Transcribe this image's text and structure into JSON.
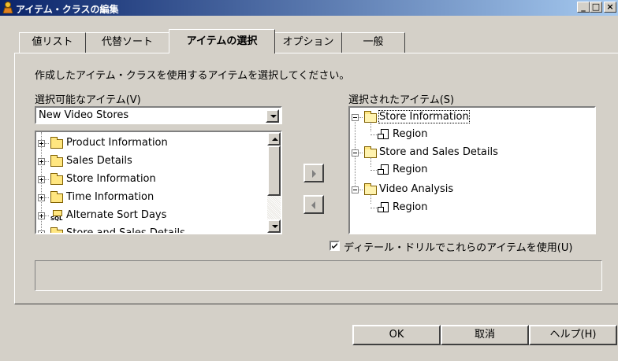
{
  "window": {
    "title": "アイテム・クラスの編集"
  },
  "titlebar_buttons": {
    "minimize": "_",
    "maximize": "□",
    "close": "×"
  },
  "tabs": [
    {
      "label": "値リスト"
    },
    {
      "label": "代替ソート"
    },
    {
      "label": "アイテムの選択",
      "active": true
    },
    {
      "label": "オプション"
    },
    {
      "label": "一般"
    }
  ],
  "instruction": "作成したアイテム・クラスを使用するアイテムを選択してください。",
  "available": {
    "label": "選択可能なアイテム(V)",
    "combo_value": "New Video Stores",
    "items": [
      {
        "label": "Product Information",
        "icon": "folder-icon"
      },
      {
        "label": "Sales Details",
        "icon": "folder-icon"
      },
      {
        "label": "Store Information",
        "icon": "folder-icon"
      },
      {
        "label": "Time Information",
        "icon": "folder-icon"
      },
      {
        "label": "Alternate Sort Days",
        "icon": "sql-folder-icon"
      },
      {
        "label": "Store and Sales Details",
        "icon": "folder-icon"
      }
    ]
  },
  "selected": {
    "label": "選択されたアイテム(S)",
    "items": [
      {
        "label": "Store Information",
        "icon": "open-folder-icon",
        "focused": true
      },
      {
        "label": "Region",
        "icon": "item-icon"
      },
      {
        "label": "Store and Sales Details",
        "icon": "open-folder-icon"
      },
      {
        "label": "Region",
        "icon": "item-icon"
      },
      {
        "label": "Video Analysis",
        "icon": "open-folder-icon"
      },
      {
        "label": "Region",
        "icon": "item-icon"
      }
    ]
  },
  "drill_checkbox": {
    "label": "ディテール・ドリルでこれらのアイテムを使用(U)",
    "checked": true
  },
  "buttons": {
    "ok": "OK",
    "cancel": "取消",
    "help": "ヘルプ(H)"
  },
  "colors": {
    "face": "#d4d0c8",
    "title_start": "#0a246a",
    "title_end": "#a6caf0",
    "folder": "#ffe680"
  }
}
